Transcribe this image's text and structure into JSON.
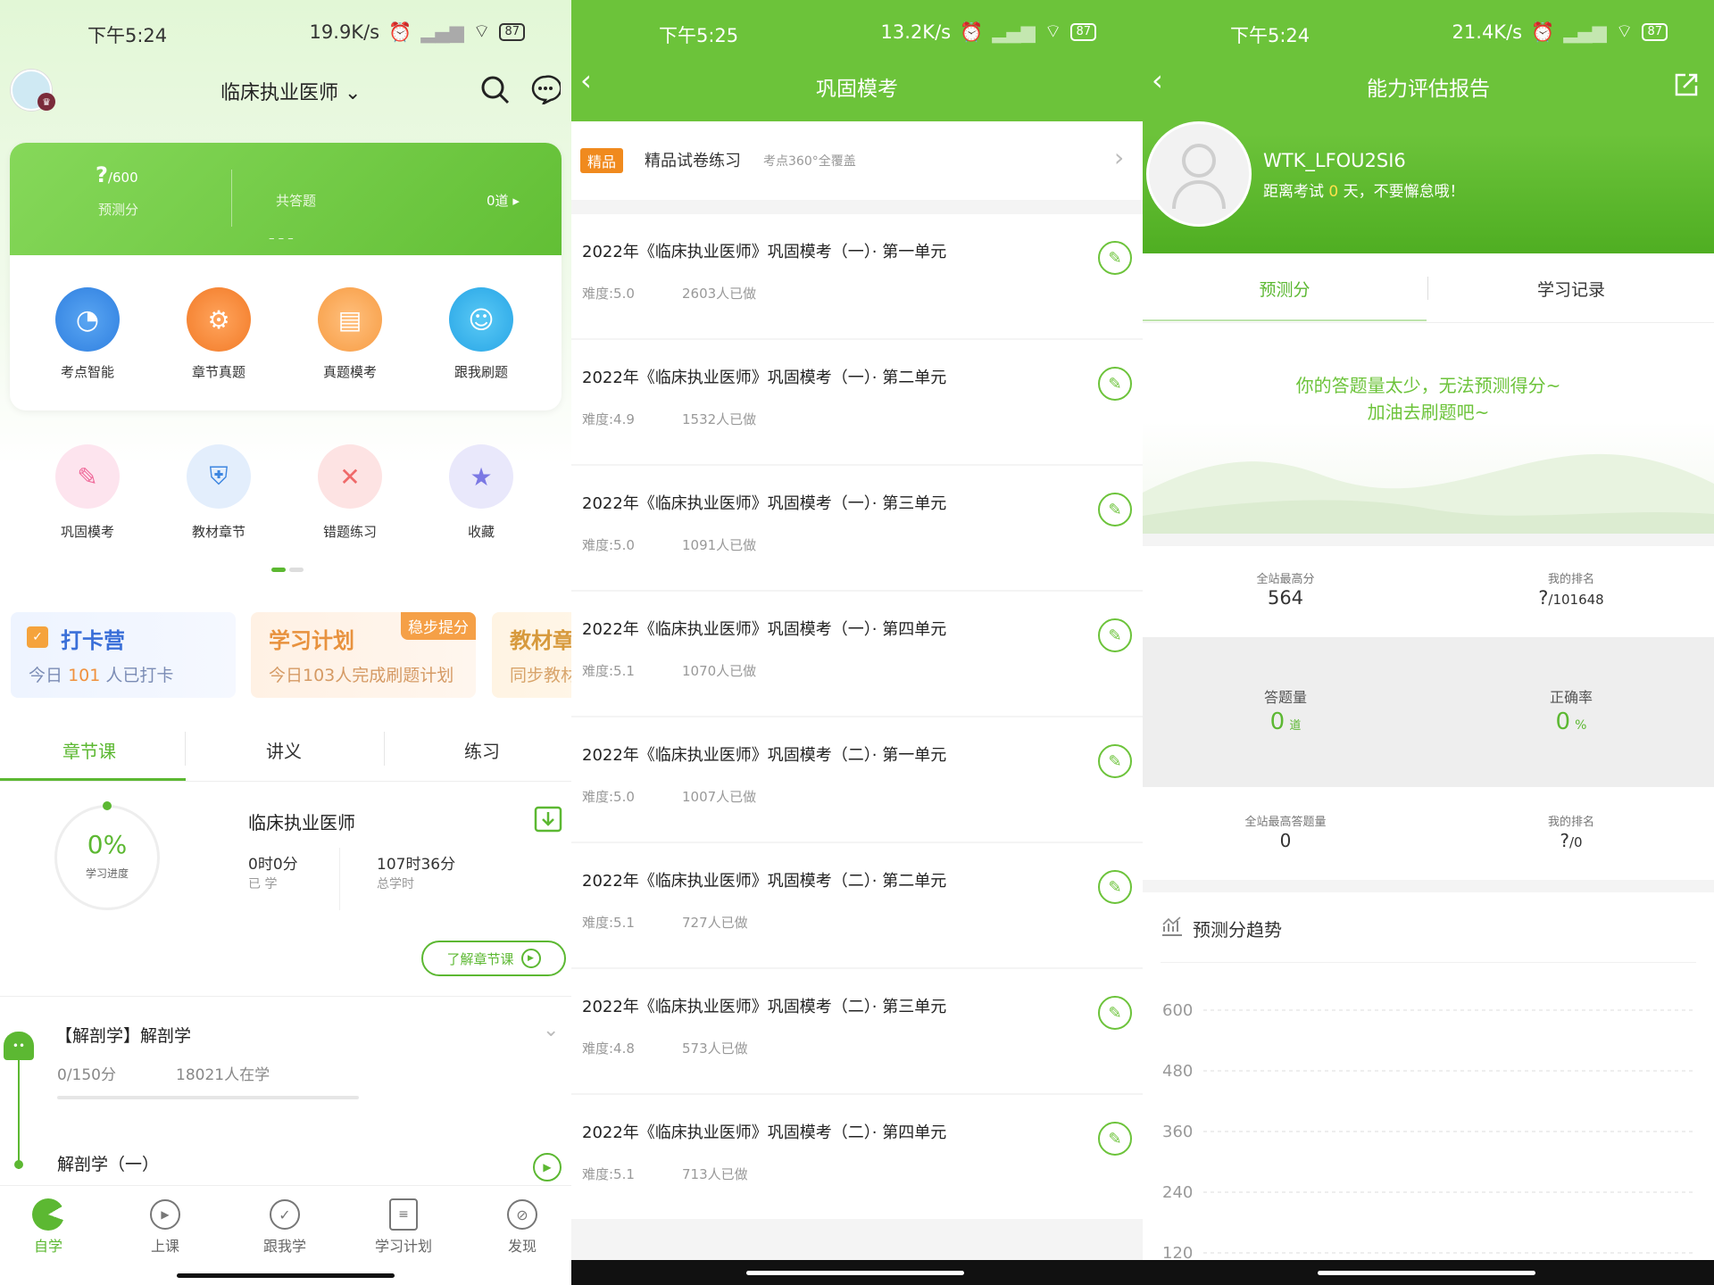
{
  "colors": {
    "accent": "#5cb832",
    "bar_green": "#6cc33a",
    "orange": "#f0913d",
    "pink": "#f4708a",
    "blue": "#3f8de6"
  },
  "p1": {
    "status": {
      "time": "下午5:24",
      "speed": "19.9K/s",
      "battery": "87"
    },
    "header": {
      "title": "临床执业医师"
    },
    "score": {
      "predict_value": "?",
      "predict_total": "/600",
      "predict_label": "预测分",
      "answered_label": "共答题",
      "answered_count": "0道",
      "dashes": "– – –"
    },
    "grid1": [
      "考点智能",
      "章节真题",
      "真题模考",
      "跟我刷题"
    ],
    "grid2": [
      "巩固模考",
      "教材章节",
      "错题练习",
      "收藏"
    ],
    "cards": [
      {
        "title": "打卡营",
        "sub_pre": "今日",
        "sub_num": "101",
        "sub_post": "人已打卡"
      },
      {
        "title": "学习计划",
        "sub": "今日103人完成刷题计划",
        "tag": "稳步提分"
      },
      {
        "title": "教材章",
        "sub": "同步教材"
      }
    ],
    "tabs": [
      "章节课",
      "讲义",
      "练习"
    ],
    "course": {
      "percent": "0%",
      "progress_label": "学习进度",
      "title": "临床执业医师",
      "learned": "0时0分",
      "learned_label": "已 学",
      "total": "107时36分",
      "total_label": "总学时",
      "more_button": "了解章节课"
    },
    "chapter": {
      "title": "【解剖学】解剖学",
      "score": "0/150分",
      "learners": "18021人在学",
      "sub_title": "解剖学（一）"
    },
    "nav": [
      "自学",
      "上课",
      "跟我学",
      "学习计划",
      "发现"
    ]
  },
  "p2": {
    "status": {
      "time": "下午5:25",
      "speed": "13.2K/s",
      "battery": "87"
    },
    "header": {
      "title": "巩固模考"
    },
    "promo": {
      "badge": "精品",
      "title": "精品试卷练习",
      "sub": "考点360°全覆盖"
    },
    "items": [
      {
        "title": "2022年《临床执业医师》巩固模考（一）· 第一单元",
        "difficulty": "难度:5.0",
        "done": "2603人已做"
      },
      {
        "title": "2022年《临床执业医师》巩固模考（一）· 第二单元",
        "difficulty": "难度:4.9",
        "done": "1532人已做"
      },
      {
        "title": "2022年《临床执业医师》巩固模考（一）· 第三单元",
        "difficulty": "难度:5.0",
        "done": "1091人已做"
      },
      {
        "title": "2022年《临床执业医师》巩固模考（一）· 第四单元",
        "difficulty": "难度:5.1",
        "done": "1070人已做"
      },
      {
        "title": "2022年《临床执业医师》巩固模考（二）· 第一单元",
        "difficulty": "难度:5.0",
        "done": "1007人已做"
      },
      {
        "title": "2022年《临床执业医师》巩固模考（二）· 第二单元",
        "difficulty": "难度:5.1",
        "done": "727人已做"
      },
      {
        "title": "2022年《临床执业医师》巩固模考（二）· 第三单元",
        "difficulty": "难度:4.8",
        "done": "573人已做"
      },
      {
        "title": "2022年《临床执业医师》巩固模考（二）· 第四单元",
        "difficulty": "难度:5.1",
        "done": "713人已做"
      }
    ]
  },
  "p3": {
    "status": {
      "time": "下午5:24",
      "speed": "21.4K/s",
      "battery": "87"
    },
    "header": {
      "title": "能力评估报告"
    },
    "user": {
      "name": "WTK_LFOU2SI6",
      "exam_pre": "距离考试",
      "exam_days": "0",
      "exam_post": "天，不要懈怠哦！"
    },
    "tabs": [
      "预测分",
      "学习记录"
    ],
    "notice": [
      "你的答题量太少，无法预测得分~",
      "加油去刷题吧~"
    ],
    "stats1": {
      "top_label": "全站最高分",
      "top_value": "564",
      "rank_label": "我的排名",
      "rank_value": "?",
      "rank_total": "/101648"
    },
    "stats2": {
      "answered_label": "答题量",
      "answered_value": "0",
      "answered_unit": "道",
      "accuracy_label": "正确率",
      "accuracy_value": "0",
      "accuracy_unit": "%"
    },
    "stats3": {
      "top_label": "全站最高答题量",
      "top_value": "0",
      "rank_label": "我的排名",
      "rank_value": "?",
      "rank_total": "/0"
    },
    "trend_title": "预测分趋势"
  },
  "chart_data": {
    "type": "line",
    "title": "预测分趋势",
    "y_ticks": [
      600,
      480,
      360,
      240,
      120
    ],
    "series": []
  }
}
